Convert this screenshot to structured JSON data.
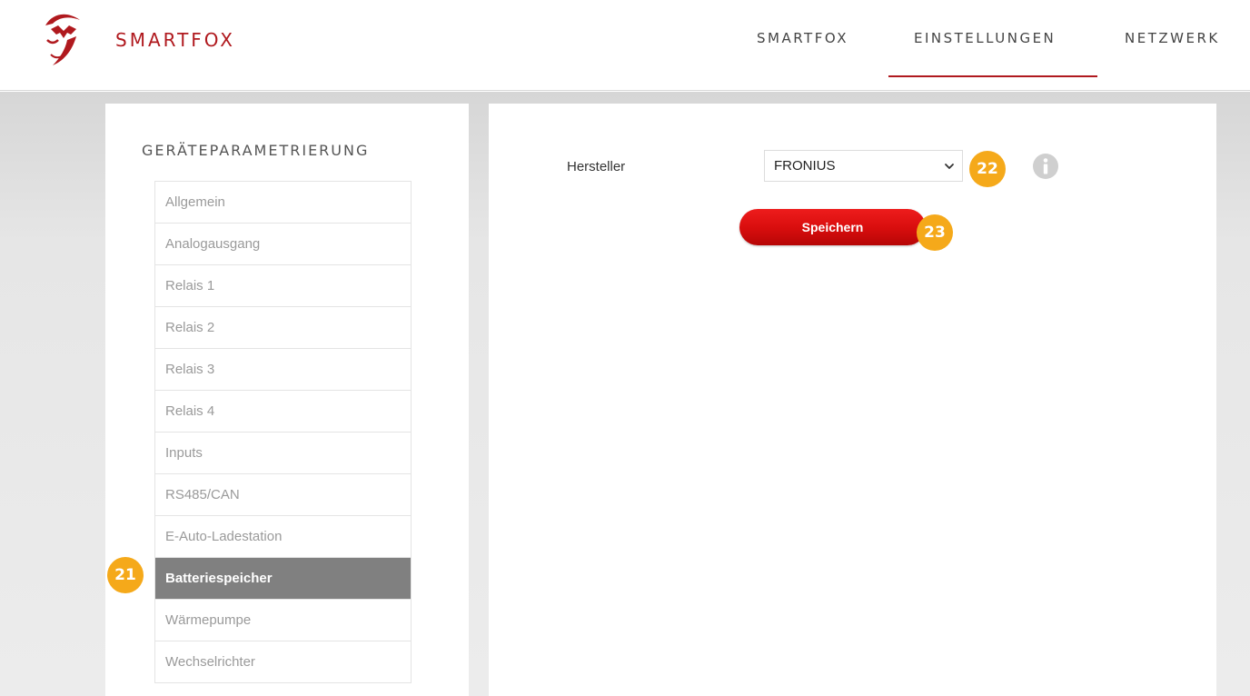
{
  "header": {
    "logo_text": "SMARTFOX",
    "nav": [
      {
        "label": "SMARTFOX"
      },
      {
        "label": "EINSTELLUNGEN"
      },
      {
        "label": "NETZWERK"
      }
    ],
    "active_nav": "EINSTELLUNGEN"
  },
  "sidebar": {
    "title": "GERÄTEPARAMETRIERUNG",
    "items": [
      {
        "label": "Allgemein"
      },
      {
        "label": "Analogausgang"
      },
      {
        "label": "Relais 1"
      },
      {
        "label": "Relais 2"
      },
      {
        "label": "Relais 3"
      },
      {
        "label": "Relais 4"
      },
      {
        "label": "Inputs"
      },
      {
        "label": "RS485/CAN"
      },
      {
        "label": "E-Auto-Ladestation"
      },
      {
        "label": "Batteriespeicher"
      },
      {
        "label": "Wärmepumpe"
      },
      {
        "label": "Wechselrichter"
      }
    ],
    "active_item": "Batteriespeicher"
  },
  "form": {
    "hersteller_label": "Hersteller",
    "hersteller_value": "FRONIUS",
    "save_label": "Speichern"
  },
  "badges": {
    "b21": "21",
    "b22": "22",
    "b23": "23"
  },
  "colors": {
    "brand": "#b0191e",
    "badge": "#f5a91a",
    "active_menu": "#808080",
    "button": "#d70d0d"
  },
  "icons": {
    "logo": "fox-logo-icon",
    "dropdown": "chevron-down-icon",
    "info": "info-icon"
  }
}
